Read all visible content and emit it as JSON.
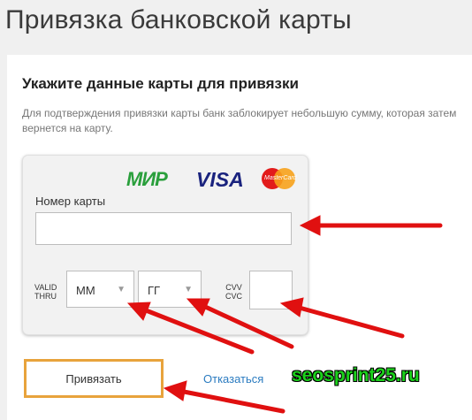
{
  "page": {
    "title": "Привязка банковской карты"
  },
  "form": {
    "heading": "Укажите данные карты для привязки",
    "description": "Для подтверждения привязки карты банк заблокирует небольшую сумму, которая затем вернется на карту."
  },
  "card": {
    "logos": {
      "mir": "МИР",
      "visa": "VISA",
      "mastercard": "MasterCard"
    },
    "number_label": "Номер карты",
    "number_value": "",
    "valid_thru_line1": "VALID",
    "valid_thru_line2": "THRU",
    "month_value": "ММ",
    "year_value": "ГГ",
    "cvv_label_line1": "CVV",
    "cvv_label_line2": "CVC",
    "cvv_value": ""
  },
  "actions": {
    "bind_label": "Привязать",
    "cancel_label": "Отказаться"
  },
  "watermark": "seosprint25.ru",
  "colors": {
    "accent": "#e8a33c",
    "link": "#2a7bc0",
    "arrow": "#e01010"
  },
  "icons": {
    "select_arrow": "arrow-down-icon",
    "annotation": "red-arrow-icon"
  }
}
